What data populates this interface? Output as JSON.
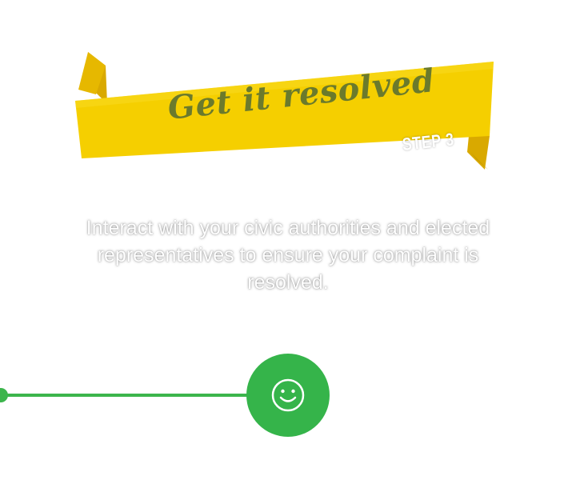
{
  "banner": {
    "title": "Get it resolved",
    "step_label": "STEP 3"
  },
  "description": "Interact with your civic authorities and elected representatives to ensure your complaint is resolved.",
  "timeline": {
    "icon": "smiley-icon"
  },
  "colors": {
    "ribbon": "#f5cf00",
    "ribbon_fold": "#d9a900",
    "title": "#6b7a2c",
    "accent_green": "#35b44a"
  }
}
